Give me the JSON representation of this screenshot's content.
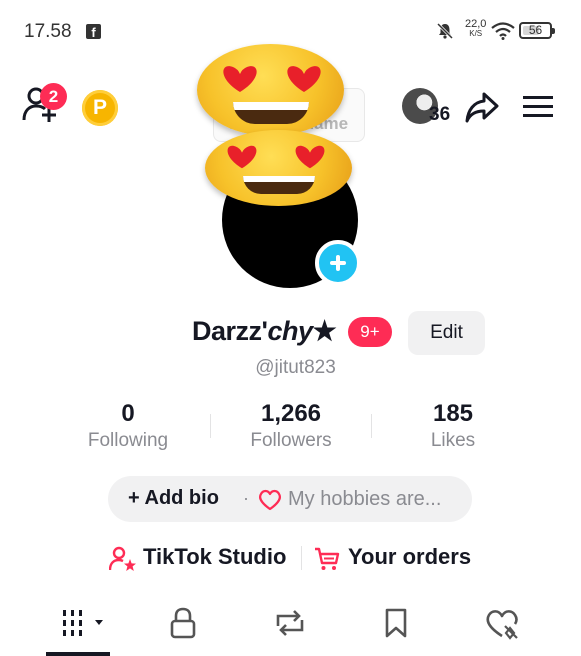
{
  "status_bar": {
    "time": "17.58",
    "net_speed": "22,0",
    "net_unit": "K/S",
    "battery": "56"
  },
  "header": {
    "friend_requests_badge": "2",
    "coin_label": "P",
    "viewers_count": "36"
  },
  "profile": {
    "username_card": "Add username",
    "display_name_main": "Darzz'",
    "display_name_italic": "chy",
    "display_name_star": "★",
    "notifications_badge": "9+",
    "edit_label": "Edit",
    "handle": "@jitut823"
  },
  "stats": [
    {
      "value": "0",
      "label": "Following"
    },
    {
      "value": "1,266",
      "label": "Followers"
    },
    {
      "value": "185",
      "label": "Likes"
    }
  ],
  "bio": {
    "add_label": "+ Add bio",
    "separator": "·",
    "hint": "My hobbies are..."
  },
  "links": {
    "studio": "TikTok Studio",
    "orders": "Your orders"
  },
  "tabs": {
    "icons": [
      "grid-icon",
      "lock-icon",
      "repost-icon",
      "bookmark-icon",
      "liked-icon"
    ],
    "active": "grid-icon"
  },
  "colors": {
    "accent_red": "#fe2c55",
    "add_photo_blue": "#21c3f3",
    "coin_gold": "#f7b500"
  }
}
